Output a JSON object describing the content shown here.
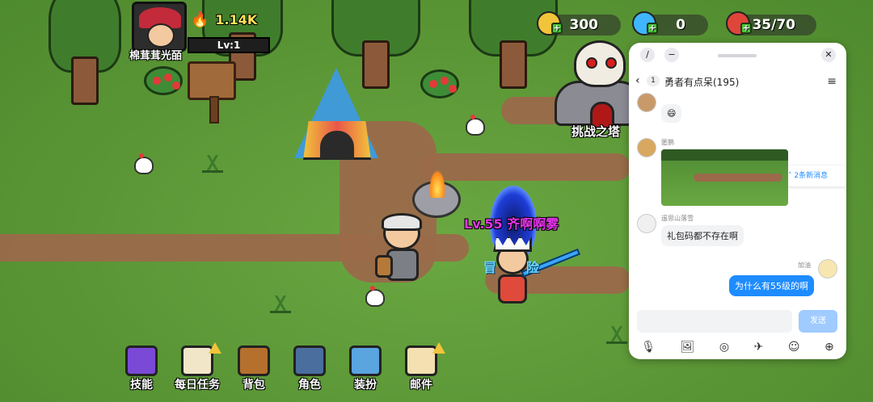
{
  "player": {
    "name": "棉茸茸光皕",
    "power": "1.14K",
    "level": "Lv:1"
  },
  "resources": [
    {
      "name": "gold-coin",
      "value": "300",
      "color": "#f2c43a"
    },
    {
      "name": "blue-gem",
      "value": "0",
      "color": "#3fb6ff"
    },
    {
      "name": "stamina-meat",
      "value": "35/70",
      "color": "#e0453a"
    }
  ],
  "world": {
    "tower_label": "挑战之塔",
    "enemy_label": "Lv.55 齐啊啊雾",
    "adventure_left": "冒",
    "adventure_right": "险"
  },
  "bottom_menu": [
    {
      "label": "技能",
      "color": "#7a4ad6",
      "warn": false
    },
    {
      "label": "每日任务",
      "color": "#f1e6c8",
      "warn": true
    },
    {
      "label": "背包",
      "color": "#b5702e",
      "warn": false
    },
    {
      "label": "角色",
      "color": "#4a6e9e",
      "warn": false
    },
    {
      "label": "装扮",
      "color": "#5aa4e0",
      "warn": false
    },
    {
      "label": "邮件",
      "color": "#f4e0b0",
      "warn": true
    }
  ],
  "chat": {
    "unread_count": "1",
    "group_title": "勇者有点呆(195)",
    "new_messages": "2条新消息",
    "messages": [
      {
        "sender": "匿鹏",
        "type": "image"
      },
      {
        "sender": "遥思山落雪",
        "text": "礼包码都不存在啊"
      },
      {
        "sender": "加油",
        "text": "为什么有55级的啊",
        "mine": true
      }
    ],
    "send_label": "发送",
    "icons": [
      "mic-icon",
      "image-icon",
      "camera-icon",
      "sticker-icon",
      "emoji-icon",
      "plus-icon"
    ]
  }
}
